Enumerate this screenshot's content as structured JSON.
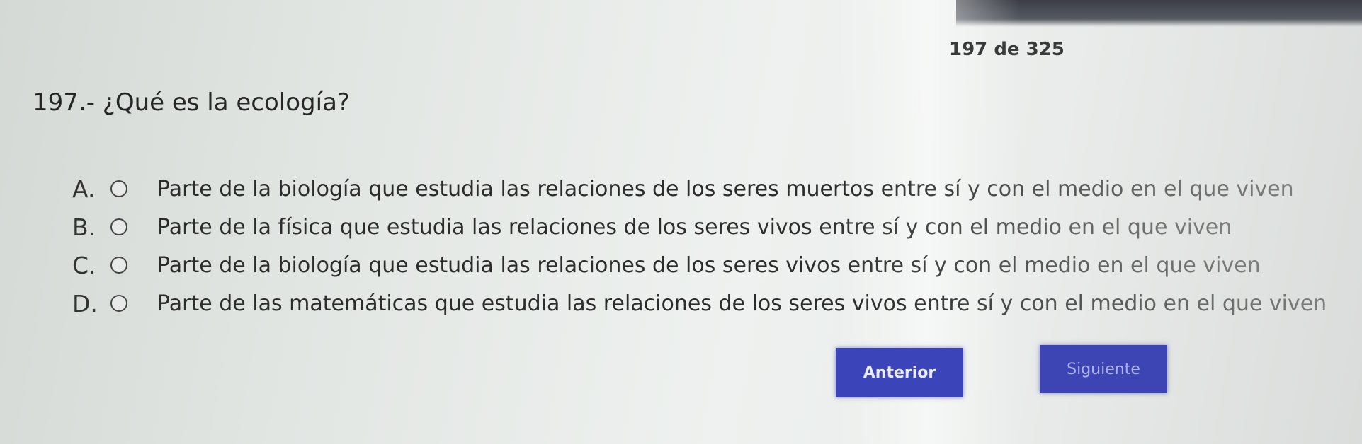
{
  "counter": "197 de 325",
  "question": "197.- ¿Qué es la ecología?",
  "options": [
    {
      "letter": "A.",
      "text": "Parte de la biología que estudia las relaciones de los seres muertos entre sí y con el medio en el que viven"
    },
    {
      "letter": "B.",
      "text": "Parte de la física que estudia las relaciones de los seres vivos entre sí y con el medio en el que viven"
    },
    {
      "letter": "C.",
      "text": "Parte de la biología que estudia las relaciones de los seres vivos entre sí y con el medio en el que viven"
    },
    {
      "letter": "D.",
      "text": "Parte de las matemáticas que estudia las relaciones de los seres vivos entre sí y con el medio en el que viven"
    }
  ],
  "buttons": {
    "prev": "Anterior",
    "next": "Siguiente"
  },
  "colors": {
    "button_bg": "#3b44b8",
    "text": "#2b2b2b"
  }
}
